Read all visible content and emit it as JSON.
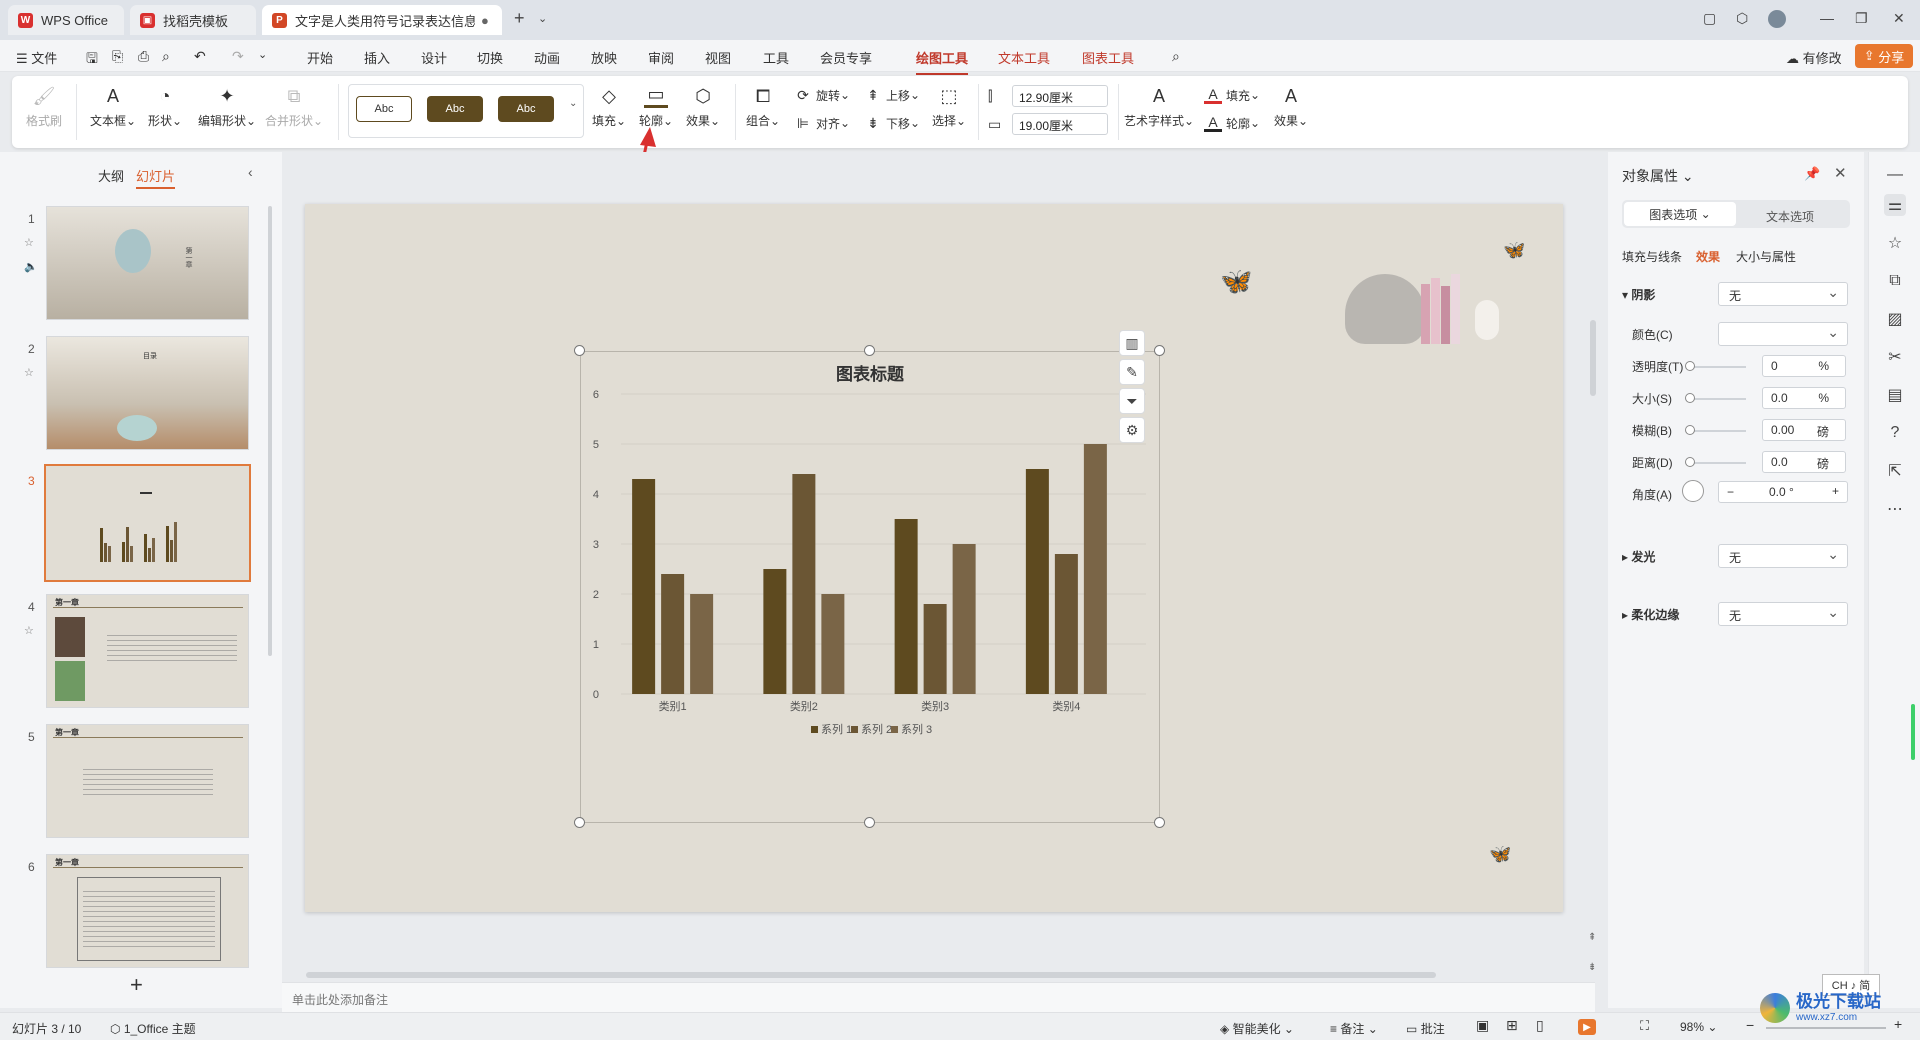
{
  "tabs": [
    {
      "label": "WPS Office",
      "icon": "wps-logo-icon",
      "color": "#d9302f"
    },
    {
      "label": "找稻壳模板",
      "icon": "docer-icon",
      "color": "#d9302f"
    },
    {
      "label": "文字是人类用符号记录表达信息以",
      "icon": "ppt-file-icon",
      "color": "#d24726"
    }
  ],
  "menu": {
    "file": "文件",
    "items": [
      "开始",
      "插入",
      "设计",
      "切换",
      "动画",
      "放映",
      "审阅",
      "视图",
      "工具",
      "会员专享",
      "绘图工具",
      "文本工具",
      "图表工具"
    ],
    "active": "绘图工具",
    "modified": "有修改",
    "share": "分享"
  },
  "ribbon": {
    "format_painter": "格式刷",
    "textbox": "文本框",
    "shape": "形状",
    "edit_shape": "编辑形状",
    "merge_shape": "合并形状",
    "style_samples": [
      "Abc",
      "Abc",
      "Abc"
    ],
    "fill": "填充",
    "outline": "轮廓",
    "effect": "效果",
    "group": "组合",
    "rotate": "旋转",
    "align": "对齐",
    "bring_up": "上移",
    "send_down": "下移",
    "select": "选择",
    "height": "12.90厘米",
    "width": "19.00厘米",
    "art_text": "艺术字样式",
    "text_fill": "填充",
    "text_outline": "轮廓",
    "text_effect": "效果"
  },
  "left_panel": {
    "outline_tab": "大纲",
    "slides_tab": "幻灯片",
    "slide_numbers": [
      "1",
      "2",
      "3",
      "4",
      "5",
      "6"
    ],
    "selected": "3",
    "slide4_title": "第一章",
    "slide5_title": "第一章",
    "slide6_title": "第一章",
    "slide2_title": "目录",
    "slide1_title": "第一章"
  },
  "chart_data": {
    "type": "bar",
    "title": "图表标题",
    "categories": [
      "类别1",
      "类别2",
      "类别3",
      "类别4"
    ],
    "series": [
      {
        "name": "系列 1",
        "values": [
          4.3,
          2.5,
          3.5,
          4.5
        ],
        "color": "#5e4a1f"
      },
      {
        "name": "系列 2",
        "values": [
          2.4,
          4.4,
          1.8,
          2.8
        ],
        "color": "#6b5634"
      },
      {
        "name": "系列 3",
        "values": [
          2.0,
          2.0,
          3.0,
          5.0
        ],
        "color": "#7a6547"
      }
    ],
    "yticks": [
      "0",
      "1",
      "2",
      "3",
      "4",
      "5",
      "6"
    ],
    "ylim": [
      0,
      6
    ],
    "legend": "bottom",
    "grid": true
  },
  "notes_placeholder": "单击此处添加备注",
  "right_panel": {
    "title": "对象属性",
    "tab_chart": "图表选项",
    "tab_text": "文本选项",
    "subtabs": [
      "填充与线条",
      "效果",
      "大小与属性"
    ],
    "active_subtab": "效果",
    "shadow": "阴影",
    "shadow_value": "无",
    "color_label": "颜色(C)",
    "transparency_label": "透明度(T)",
    "transparency_value": "0",
    "transparency_unit": "%",
    "size_label": "大小(S)",
    "size_value": "0.0",
    "size_unit": "%",
    "blur_label": "模糊(B)",
    "blur_value": "0.00",
    "blur_unit": "磅",
    "distance_label": "距离(D)",
    "distance_value": "0.0",
    "distance_unit": "磅",
    "angle_label": "角度(A)",
    "angle_value": "0.0 °",
    "angle_minus": "−",
    "angle_plus": "+",
    "glow": "发光",
    "glow_value": "无",
    "soft_edge": "柔化边缘",
    "soft_edge_value": "无"
  },
  "status": {
    "slide_info": "幻灯片 3 / 10",
    "theme": "1_Office 主题",
    "smart": "智能美化",
    "notes": "备注",
    "comment": "批注",
    "zoom": "98%",
    "ime": "CH ♪ 简"
  },
  "watermark": "极光下载站",
  "watermark_url": "www.xz7.com"
}
